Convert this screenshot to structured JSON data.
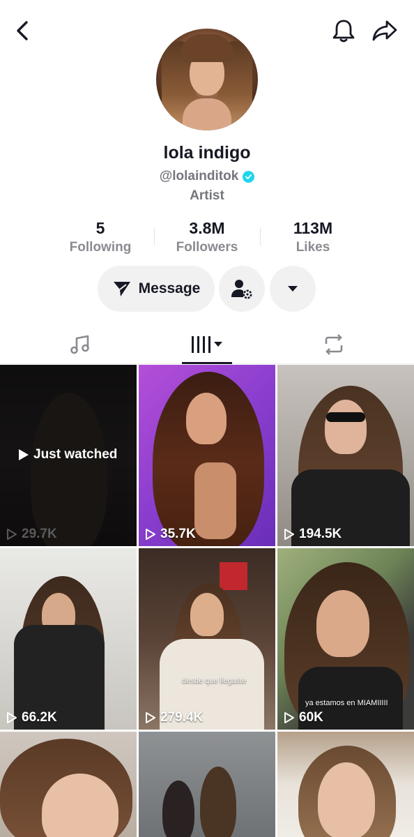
{
  "header": {
    "icons": {
      "back": "chevron-left-icon",
      "notifications": "bell-icon",
      "share": "share-arrow-icon"
    }
  },
  "profile": {
    "display_name": "lola indigo",
    "username": "@lolainditok",
    "verified": true,
    "bio": "Artist"
  },
  "stats": [
    {
      "value": "5",
      "label": "Following"
    },
    {
      "value": "3.8M",
      "label": "Followers"
    },
    {
      "value": "113M",
      "label": "Likes"
    }
  ],
  "actions": {
    "message_label": "Message",
    "icons": {
      "message": "send-plane-icon",
      "follow_settings": "user-settings-icon",
      "more": "caret-down-icon"
    }
  },
  "tabs": [
    {
      "name": "music",
      "icon": "music-note-icon"
    },
    {
      "name": "videos",
      "icon": "grid-columns-icon",
      "active": true
    },
    {
      "name": "reposts",
      "icon": "repost-icon"
    }
  ],
  "videos": [
    {
      "views": "29.7K",
      "overlay": "Just watched"
    },
    {
      "views": "35.7K"
    },
    {
      "views": "194.5K"
    },
    {
      "views": "66.2K"
    },
    {
      "views": "279.4K",
      "caption": "desde que llegaste"
    },
    {
      "views": "60K",
      "caption": "ya estamos en MIAMIIIII"
    },
    {
      "views": ""
    },
    {
      "views": ""
    },
    {
      "views": ""
    }
  ],
  "colors": {
    "verified_badge": "#20d5ec",
    "text_primary": "#161823",
    "text_secondary": "#75767c",
    "button_bg": "#f1f1f2"
  }
}
